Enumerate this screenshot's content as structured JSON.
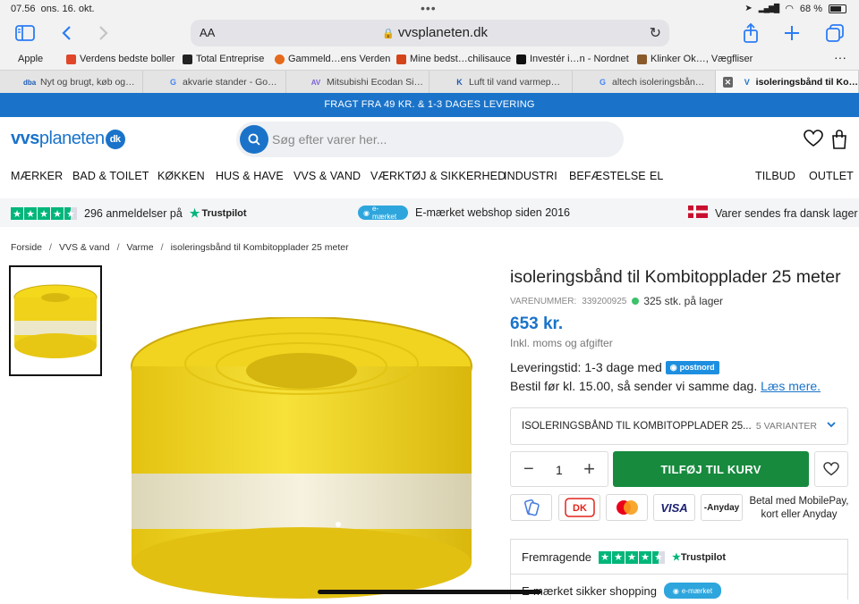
{
  "status": {
    "time": "07.56",
    "date": "ons. 16. okt.",
    "battery": "68 %"
  },
  "browser": {
    "text_size_label": "AA",
    "url": "vvsplaneten.dk",
    "favorites": [
      {
        "label": "Apple",
        "icon": "apple-icon",
        "color": "#111111"
      },
      {
        "label": "Verdens bedste boller",
        "icon": "bookmark-favicon",
        "color": "#e0462a"
      },
      {
        "label": "Total Entreprise",
        "icon": "bookmark-favicon",
        "color": "#222222"
      },
      {
        "label": "Gammeld…ens Verden",
        "icon": "bookmark-favicon",
        "color": "#e66a1c"
      },
      {
        "label": "Mine bedst…chilisauce",
        "icon": "bookmark-favicon",
        "color": "#d4441a"
      },
      {
        "label": "Investér i…n - Nordnet",
        "icon": "bookmark-favicon",
        "color": "#111111"
      },
      {
        "label": "Klinker Ok…, Vægfliser",
        "icon": "bookmark-favicon",
        "color": "#8b5a2b"
      }
    ],
    "tabs": [
      {
        "label": "Nyt og brugt, køb og…",
        "icon": "dba",
        "color": "#1c5bb3"
      },
      {
        "label": "akvarie stander - Go…",
        "icon": "G",
        "color": "#4285f4"
      },
      {
        "label": "Mitsubishi Ecodan Si…",
        "icon": "AV",
        "color": "#7d5fd8"
      },
      {
        "label": "Luft til vand varmep…",
        "icon": "K",
        "color": "#1c5bb3"
      },
      {
        "label": "altech isoleringsbån…",
        "icon": "G",
        "color": "#4285f4"
      },
      {
        "label": "isoleringsbånd til Ko…",
        "icon": "V",
        "color": "#1a73c9"
      }
    ]
  },
  "site": {
    "shipping_banner": "FRAGT FRA 49 KR. & 1-3 DAGES LEVERING",
    "logo": {
      "part1": "vvs",
      "part2": "planeten",
      "badge": "dk"
    },
    "search_placeholder": "Søg efter varer her...",
    "nav": [
      "MÆRKER",
      "BAD & TOILET",
      "KØKKEN",
      "HUS & HAVE",
      "VVS & VAND",
      "VÆRKTØJ & SIKKERHED",
      "INDUSTRI",
      "BEFÆSTELSE",
      "EL",
      "TILBUD",
      "OUTLET"
    ],
    "trust": {
      "reviews": "296 anmeldelser på",
      "trustpilot": "Trustpilot",
      "emaerket_badge": "e-mærket",
      "emaerket": "E-mærket webshop siden 2016",
      "ships": "Varer sendes fra dansk lager"
    },
    "brand_color": "#1a73c9",
    "trustpilot_green": "#00b67a"
  },
  "breadcrumb": [
    "Forside",
    "VVS & vand",
    "Varme",
    "isoleringsbånd til Kombitopplader 25 meter"
  ],
  "product": {
    "title": "isoleringsbånd til Kombitopplader 25 meter",
    "sku_label": "VARENUMMER:",
    "sku": "339200925",
    "stock": "325 stk. på lager",
    "price": "653 kr.",
    "vat": "Inkl. moms og afgifter",
    "delivery_label": "Leveringstid:",
    "delivery_time": "1-3 dage med",
    "carrier": "postnord",
    "order_text": "Bestil før kl. 15.00, så sender vi samme dag.",
    "read_more": "Læs mere.",
    "variant_label": "ISOLERINGSBÅND TIL KOMBITOPPLADER 25...",
    "variant_count": "5 VARIANTER",
    "quantity": "1",
    "add_to_cart": "TILFØJ TIL KURV",
    "payment_icons": [
      "mobilepay-icon",
      "dankort-icon",
      "mastercard-icon",
      "visa-icon",
      "anyday-icon"
    ],
    "visa_label": "VISA",
    "anyday_label": "Anyday",
    "payment_text_line1": "Betal med MobilePay,",
    "payment_text_line2": "kort eller Anyday",
    "review_rating_label": "Fremragende",
    "review_trustpilot": "Trustpilot",
    "secure_label": "E-mærket sikker shopping",
    "emaerket_badge": "e-mærket"
  }
}
